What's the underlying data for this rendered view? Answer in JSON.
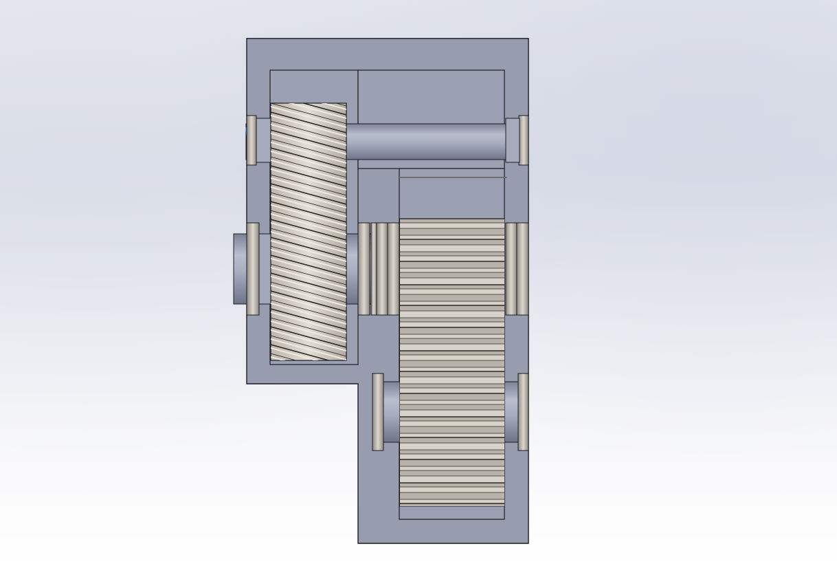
{
  "scene": {
    "view": "section view",
    "components": [
      {
        "name": "gearbox-housing",
        "color": "#979caf"
      },
      {
        "name": "helical-gear",
        "tooth_color": "#d6d0c7",
        "line_color": "#2a2a2a"
      },
      {
        "name": "spur-gear",
        "tooth_color": "#cfc9bf"
      },
      {
        "name": "upper-shaft",
        "color": "#9aa0b6"
      },
      {
        "name": "middle-shaft",
        "color": "#a0a6ba"
      },
      {
        "name": "lower-shaft",
        "color": "#a0a6ba"
      },
      {
        "name": "bearings",
        "color": "#cbc6bc"
      }
    ]
  }
}
